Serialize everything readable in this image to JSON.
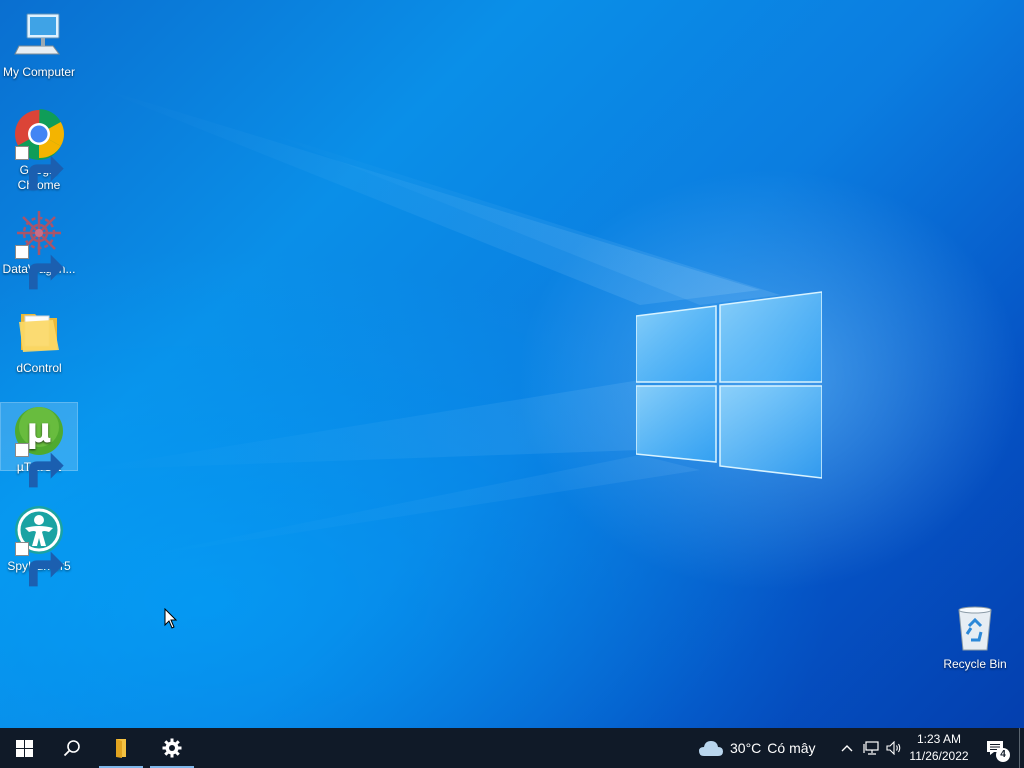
{
  "desktop": {
    "icons": [
      {
        "label": "My Computer",
        "icon": "computer-icon",
        "shortcut": false
      },
      {
        "label": "Google Chrome",
        "icon": "chrome-icon",
        "shortcut": true
      },
      {
        "label": "DataWagon...",
        "icon": "datawagon-icon",
        "shortcut": true
      },
      {
        "label": "dControl",
        "icon": "folder-icon",
        "shortcut": false
      },
      {
        "label": "µTorrent",
        "icon": "utorrent-icon",
        "shortcut": true,
        "selected": true
      },
      {
        "label": "SpyHunter5",
        "icon": "spyhunter-icon",
        "shortcut": true
      }
    ],
    "recycle_bin": {
      "label": "Recycle Bin",
      "icon": "recycle-bin-icon"
    }
  },
  "taskbar": {
    "start_icon": "windows-start-icon",
    "search_icon": "search-icon",
    "pinned": [
      {
        "name": "file-explorer",
        "icon": "folder-icon",
        "active": true
      },
      {
        "name": "settings",
        "icon": "gear-icon",
        "active": true
      }
    ],
    "weather": {
      "temperature": "30°C",
      "condition": "Có mây",
      "icon": "cloud-icon"
    },
    "tray": {
      "chevron_icon": "chevron-up-icon",
      "network_icon": "network-icon",
      "volume_icon": "volume-icon"
    },
    "clock": {
      "time": "1:23 AM",
      "date": "11/26/2022"
    },
    "notifications": {
      "count": "4",
      "icon": "notification-icon"
    }
  },
  "colors": {
    "taskbar_bg": "#101a28",
    "desktop_accent": "#0a8fe8",
    "active_indicator": "#7fb7ea"
  }
}
